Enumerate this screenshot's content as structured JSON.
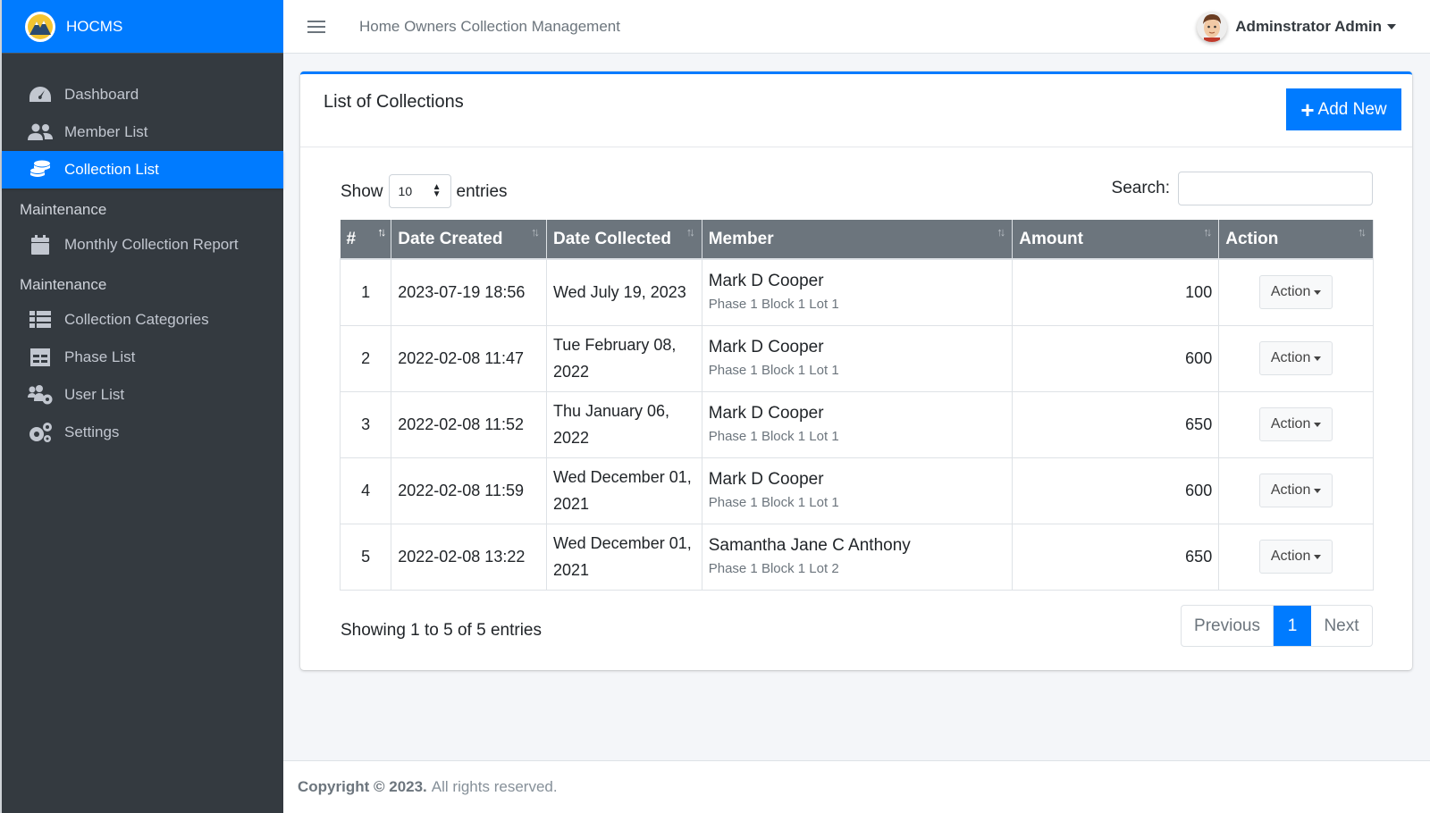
{
  "brand": {
    "name": "HOCMS"
  },
  "header": {
    "app_title": "Home Owners Collection Management",
    "user_name": "Adminstrator Admin"
  },
  "sidebar": {
    "items": [
      {
        "label": "Dashboard",
        "icon": "tachometer-icon"
      },
      {
        "label": "Member List",
        "icon": "users-icon"
      },
      {
        "label": "Collection List",
        "icon": "coins-icon",
        "active": true
      }
    ],
    "section1": {
      "header": "Maintenance",
      "items": [
        {
          "label": "Monthly Collection Report",
          "icon": "calendar-icon"
        }
      ]
    },
    "section2": {
      "header": "Maintenance",
      "items": [
        {
          "label": "Collection Categories",
          "icon": "list-icon"
        },
        {
          "label": "Phase List",
          "icon": "table-icon"
        },
        {
          "label": "User List",
          "icon": "users-cog-icon"
        },
        {
          "label": "Settings",
          "icon": "cogs-icon"
        }
      ]
    }
  },
  "card": {
    "title": "List of Collections",
    "add_new_label": "Add New"
  },
  "controls": {
    "show_label": "Show",
    "entries_value": "10",
    "entries_label": "entries",
    "search_label": "Search:"
  },
  "table": {
    "columns": [
      "#",
      "Date Created",
      "Date Collected",
      "Member",
      "Amount",
      "Action"
    ],
    "rows": [
      {
        "num": "1",
        "created": "2023-07-19 18:56",
        "collected": "Wed July 19, 2023",
        "member": "Mark D Cooper",
        "address": "Phase 1 Block 1 Lot 1",
        "amount": "100",
        "action": "Action"
      },
      {
        "num": "2",
        "created": "2022-02-08 11:47",
        "collected": "Tue February 08, 2022",
        "member": "Mark D Cooper",
        "address": "Phase 1 Block 1 Lot 1",
        "amount": "600",
        "action": "Action"
      },
      {
        "num": "3",
        "created": "2022-02-08 11:52",
        "collected": "Thu January 06, 2022",
        "member": "Mark D Cooper",
        "address": "Phase 1 Block 1 Lot 1",
        "amount": "650",
        "action": "Action"
      },
      {
        "num": "4",
        "created": "2022-02-08 11:59",
        "collected": "Wed December 01, 2021",
        "member": "Mark D Cooper",
        "address": "Phase 1 Block 1 Lot 1",
        "amount": "600",
        "action": "Action"
      },
      {
        "num": "5",
        "created": "2022-02-08 13:22",
        "collected": "Wed December 01, 2021",
        "member": "Samantha Jane C Anthony",
        "address": "Phase 1 Block 1 Lot 2",
        "amount": "650",
        "action": "Action"
      }
    ]
  },
  "info": "Showing 1 to 5 of 5 entries",
  "pagination": {
    "previous": "Previous",
    "current": "1",
    "next": "Next"
  },
  "footer": {
    "copyright": "Copyright © 2023.",
    "rights": "All rights reserved."
  },
  "colors": {
    "primary": "#007bff",
    "sidebar_bg": "#343a40",
    "header_bg": "#6c757d"
  }
}
